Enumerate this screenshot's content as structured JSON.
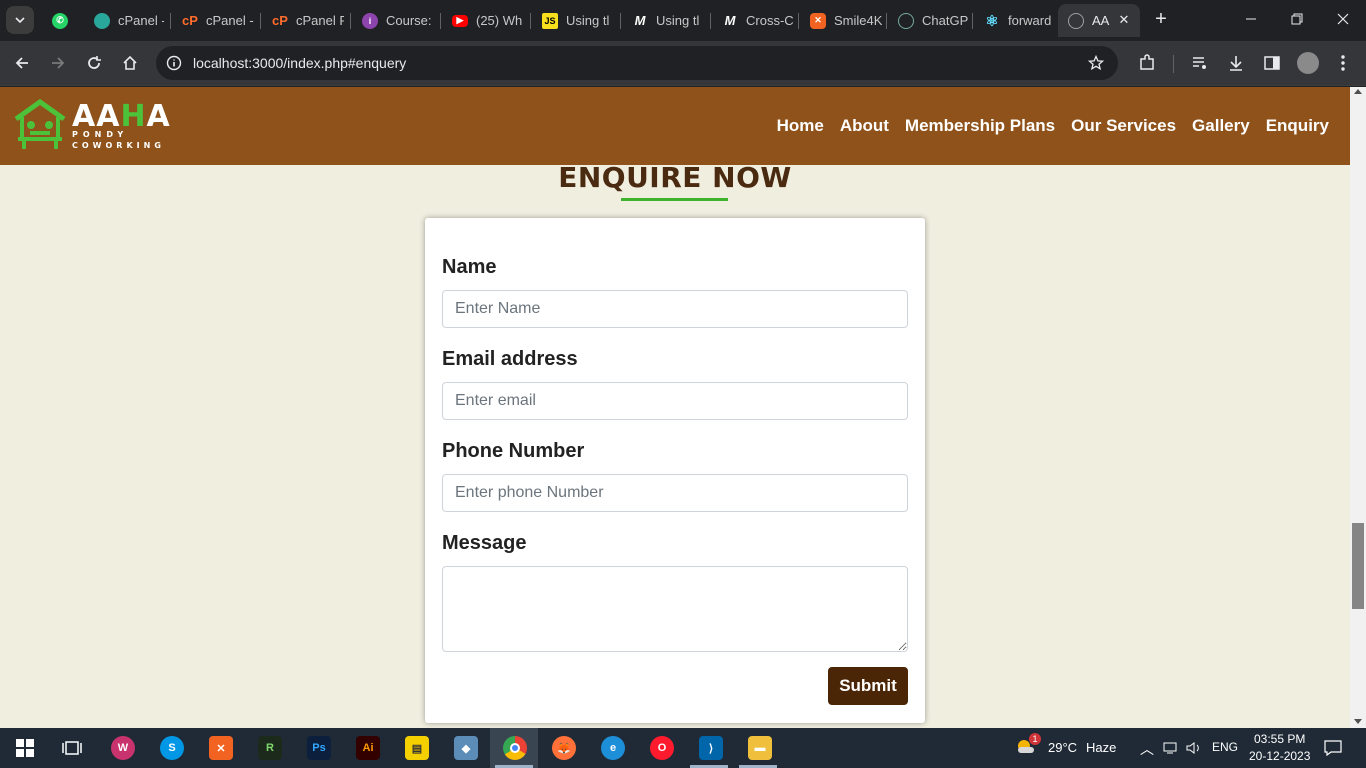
{
  "browser": {
    "tabs": [
      {
        "label": "",
        "icon": "whatsapp-icon",
        "color": "#25d366"
      },
      {
        "label": "cPanel -",
        "icon": "cpanel-icon",
        "color": "#2aa79b"
      },
      {
        "label": "cPanel -",
        "icon": "cpanel-icon",
        "color": "#ff6c2c"
      },
      {
        "label": "cPanel F",
        "icon": "cpanel-icon",
        "color": "#ff6c2c"
      },
      {
        "label": "Course:",
        "icon": "course-icon",
        "color": "#8e44ad"
      },
      {
        "label": "(25) Wh",
        "icon": "youtube-icon",
        "color": "#ff0000"
      },
      {
        "label": "Using tl",
        "icon": "js-icon",
        "color": "#f7df1e"
      },
      {
        "label": "Using tl",
        "icon": "medium-icon",
        "color": "#202124"
      },
      {
        "label": "Cross-C",
        "icon": "medium-icon",
        "color": "#202124"
      },
      {
        "label": "Smile4K",
        "icon": "smile-icon",
        "color": "#f26322"
      },
      {
        "label": "ChatGP",
        "icon": "chatgpt-icon",
        "color": "#74aa9c"
      },
      {
        "label": "forward",
        "icon": "react-icon",
        "color": "#61dafb"
      },
      {
        "label": "AAI",
        "icon": "globe-icon",
        "color": "#9aa0a6",
        "active": true
      }
    ],
    "url": "localhost:3000/index.php#enquery"
  },
  "site": {
    "logo": {
      "title_a": "AA",
      "title_h": "H",
      "title_b": "A",
      "sub1": "PONDY",
      "sub2": "COWORKING"
    },
    "nav": [
      "Home",
      "About",
      "Membership Plans",
      "Our Services",
      "Gallery",
      "Enquiry"
    ],
    "heading": "ENQUIRE NOW",
    "form": {
      "name_label": "Name",
      "name_placeholder": "Enter Name",
      "email_label": "Email address",
      "email_placeholder": "Enter email",
      "phone_label": "Phone Number",
      "phone_placeholder": "Enter phone Number",
      "message_label": "Message",
      "submit_label": "Submit"
    },
    "colors": {
      "nav_bg": "#8f521a",
      "page_bg": "#f0eedf",
      "accent_green": "#3fb22d",
      "submit_bg": "#4a2506"
    }
  },
  "taskbar": {
    "weather": {
      "temp": "29°C",
      "condition": "Haze",
      "badge": "1"
    },
    "lang": "ENG",
    "time": "03:55 PM",
    "date": "20-12-2023"
  }
}
